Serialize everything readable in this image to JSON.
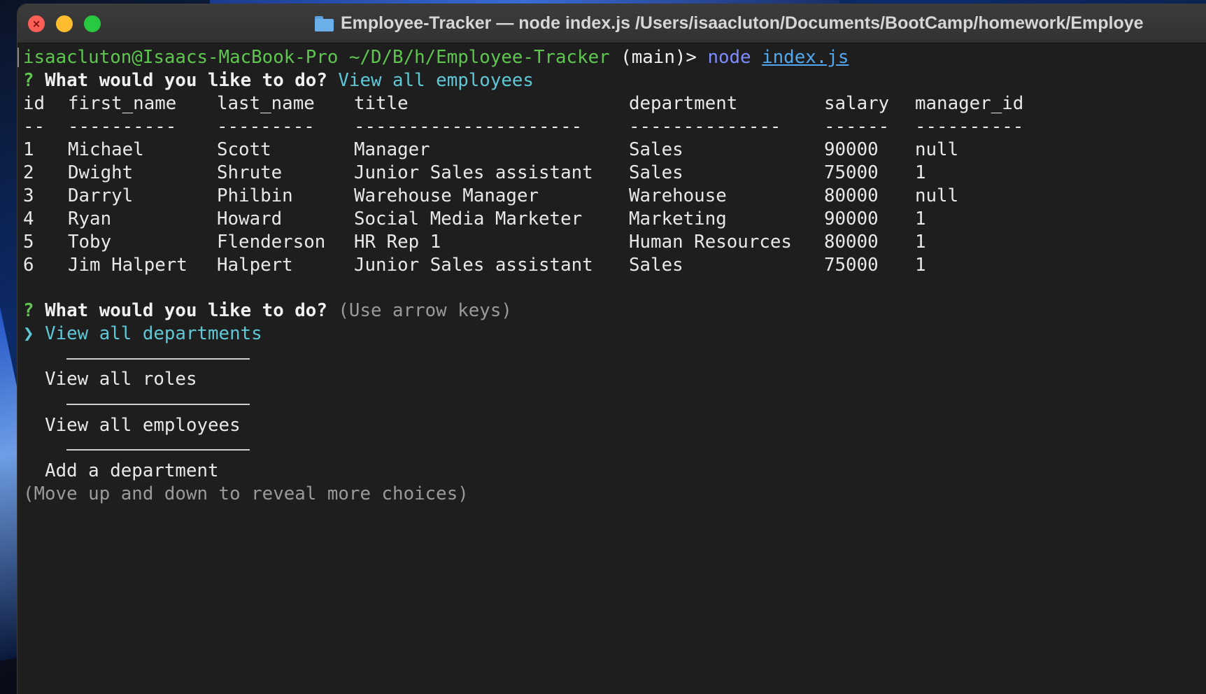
{
  "window": {
    "title": "Employee-Tracker — node index.js /Users/isaacluton/Documents/BootCamp/homework/Employe"
  },
  "prompt": {
    "user_host": "isaacluton@Isaacs-MacBook-Pro",
    "path": "~/D/B/h/Employee-Tracker",
    "branch": "(main)>",
    "command": "node",
    "argument": "index.js"
  },
  "question1": {
    "marker": "?",
    "text": "What would you like to do?",
    "answer": "View all employees"
  },
  "table": {
    "headers": [
      "id",
      "first_name",
      "last_name",
      "title",
      "department",
      "salary",
      "manager_id"
    ],
    "separators": [
      "--",
      "----------",
      "---------",
      "---------------------",
      "--------------",
      "------",
      "----------"
    ],
    "rows": [
      [
        "1",
        "Michael",
        "Scott",
        "Manager",
        "Sales",
        "90000",
        "null"
      ],
      [
        "2",
        "Dwight",
        "Shrute",
        "Junior Sales assistant",
        "Sales",
        "75000",
        "1"
      ],
      [
        "3",
        "Darryl",
        "Philbin",
        "Warehouse Manager",
        "Warehouse",
        "80000",
        "null"
      ],
      [
        "4",
        "Ryan",
        "Howard",
        "Social Media Marketer",
        "Marketing",
        "90000",
        "1"
      ],
      [
        "5",
        "Toby",
        "Flenderson",
        "HR Rep 1",
        "Human Resources",
        "80000",
        "1"
      ],
      [
        "6",
        "Jim Halpert",
        "Halpert",
        "Junior Sales assistant",
        "Sales",
        "75000",
        "1"
      ]
    ]
  },
  "question2": {
    "marker": "?",
    "text": "What would you like to do?",
    "hint": "(Use arrow keys)"
  },
  "menu": {
    "pointer": "❯",
    "selected": "View all departments",
    "items": [
      "View all roles",
      "View all employees",
      "Add a department"
    ],
    "footer": "(Move up and down to reveal more choices)"
  }
}
